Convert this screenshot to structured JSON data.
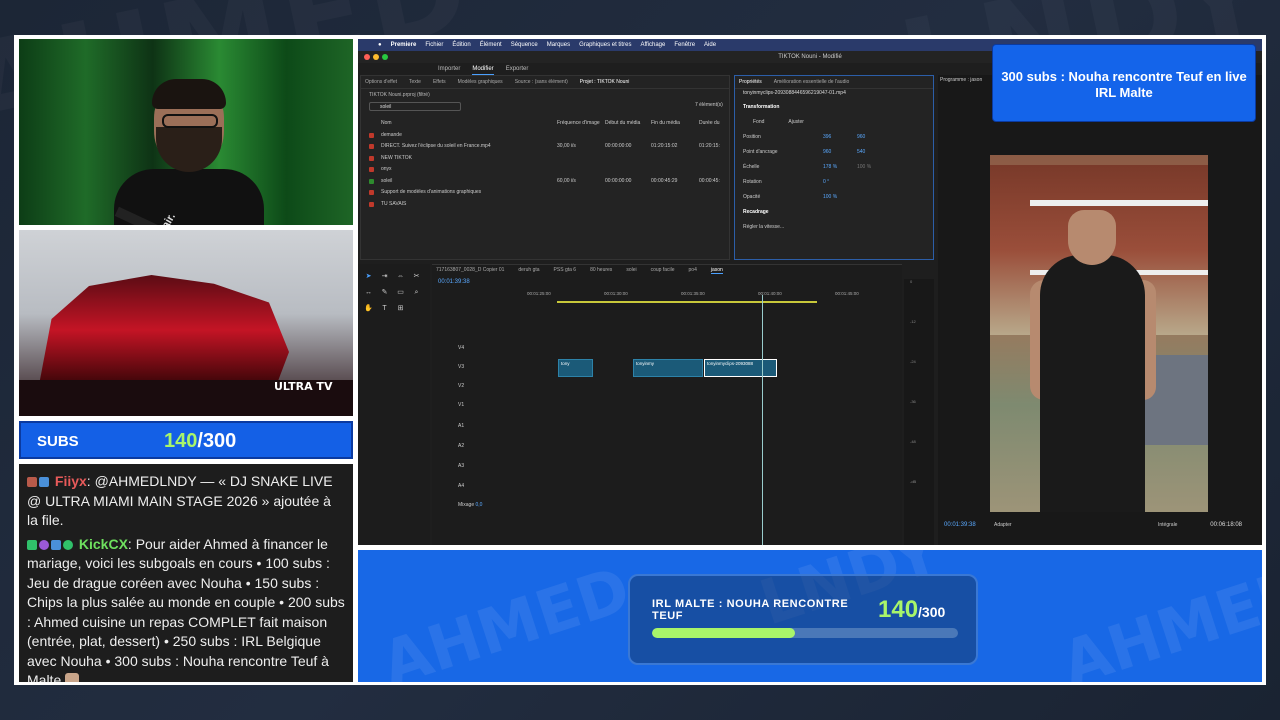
{
  "premiere": {
    "menu": [
      "Premiere",
      "Fichier",
      "Édition",
      "Élément",
      "Séquence",
      "Marques",
      "Graphiques et titres",
      "Affichage",
      "Fenêtre",
      "Aide"
    ],
    "window_title": "TIKTOK Nouni - Modifié",
    "workspace_tabs": [
      "Importer",
      "Modifier",
      "Exporter"
    ],
    "panel_tabs": [
      "Options d'effet",
      "Texte",
      "Effets",
      "Modèles graphiques",
      "Source : (sans élément)",
      "Projet : TIKTOK Nouni"
    ],
    "project_path": "TIKTOK Nouni.prproj (filtré)",
    "search_value": "soleil",
    "item_count": "7 élément(s)",
    "columns": [
      "Nom",
      "Fréquence d'image",
      "Début du média",
      "Fin du média",
      "Durée du"
    ],
    "rows": [
      {
        "name": "demande",
        "fps": "",
        "start": "",
        "end": "",
        "dur": "",
        "color": "#c0392b"
      },
      {
        "name": "DIRECT. Suivez l'éclipse du soleil en France.mp4",
        "fps": "30,00 i/s",
        "start": "00:00:00:00",
        "end": "01:20:15:02",
        "dur": "01:20:15:",
        "color": "#c0392b"
      },
      {
        "name": "NEW TIKTOK",
        "fps": "",
        "start": "",
        "end": "",
        "dur": "",
        "color": "#c0392b"
      },
      {
        "name": "onyx",
        "fps": "",
        "start": "",
        "end": "",
        "dur": "",
        "color": "#c0392b"
      },
      {
        "name": "soleil",
        "fps": "60,00 i/s",
        "start": "00:00:00:00",
        "end": "00:00:45:29",
        "dur": "00:00:45:",
        "color": "#2e8b2e"
      },
      {
        "name": "Support de modèles d'animations graphiques",
        "fps": "",
        "start": "",
        "end": "",
        "dur": "",
        "color": "#c0392b"
      },
      {
        "name": "TU SAVAIS",
        "fps": "",
        "start": "",
        "end": "",
        "dur": "",
        "color": "#c0392b"
      }
    ],
    "props": {
      "tabs": [
        "Propriétés",
        "Amélioration essentielle de l'audio"
      ],
      "file": "tonyinmyclips-2093088446596219047-01.mp4",
      "section": "Transformation",
      "fond": "Fond",
      "ajuster": "Ajuster",
      "position_label": "Position",
      "position_x": "396",
      "position_y": "960",
      "anchor_label": "Point d'ancrage",
      "anchor_x": "960",
      "anchor_y": "540",
      "scale_label": "Échelle",
      "scale_value": "178 %",
      "scale_value2": "100 %",
      "rotation_label": "Rotation",
      "rotation_value": "0 °",
      "opacity_label": "Opacité",
      "opacity_value": "100 %",
      "recadrage": "Recadrage",
      "speed": "Régler la vitesse..."
    },
    "program": {
      "title": "Programme : jason",
      "timecode": "00:01:39:38",
      "fit": "Adapter",
      "quality": "Intégrale",
      "duration": "00:06:18:08"
    },
    "timeline": {
      "tabs": [
        "717163807_0028_D Copier 01",
        "deruh gta",
        "PSS gta 6",
        "80 heures",
        "solei",
        "coup facile",
        "po4",
        "jason"
      ],
      "timecode": "00:01:39:38",
      "ruler": [
        "00:01:25:00",
        "00:01:30:00",
        "00:01:35:00",
        "00:01:40:00",
        "00:01:45:00"
      ],
      "tracks": [
        "V4",
        "V3",
        "V2",
        "V1",
        "A1",
        "A2",
        "A3",
        "A4"
      ],
      "mix_label": "Mixage",
      "mix_value": "0,0",
      "clips": [
        "tony",
        "tonyinmy",
        "tonyinmyclips-2093088"
      ]
    },
    "meter_ticks": [
      "0",
      "-3",
      "-6",
      "-9",
      "-12",
      "-15",
      "-18",
      "-21",
      "-24",
      "-27",
      "-30",
      "-33",
      "-36",
      "-39",
      "-42",
      "-45",
      "-48",
      "-51",
      "-54",
      "-57",
      "-dB"
    ]
  },
  "alert": "300 subs : Nouha rencontre Teuf en live IRL Malte",
  "subs": {
    "label": "SUBS",
    "current": "140",
    "separator": "/",
    "target": "300"
  },
  "chat": {
    "messages": [
      {
        "user": "Fiiyx",
        "text": ": @AHMEDLNDY — « DJ SNAKE LIVE @ ULTRA MIAMI MAIN STAGE 2026 » ajoutée à la file."
      },
      {
        "user": "KickCX",
        "text": ":  Pour aider Ahmed à financer le mariage, voici les subgoals en cours • 100 subs : Jeu de drague coréen avec Nouha • 150 subs : Chips la plus salée au monde en couple • 200 subs : Ahmed cuisine un repas COMPLET fait maison (entrée, plat, dessert) • 250 subs : IRL Belgique avec Nouha • 300 subs : Nouha rencontre Teuf à Malte "
      }
    ]
  },
  "goal": {
    "title": "IRL MALTE : NOUHA RENCONTRE TEUF",
    "current": "140",
    "target": "/300",
    "progress": 0.4667
  },
  "stream": {
    "logo": "ULTRA TV"
  },
  "cam": {
    "shirt_text": "clair."
  },
  "colors": {
    "accent": "#1464ea",
    "goal_green": "#a8f56a"
  }
}
